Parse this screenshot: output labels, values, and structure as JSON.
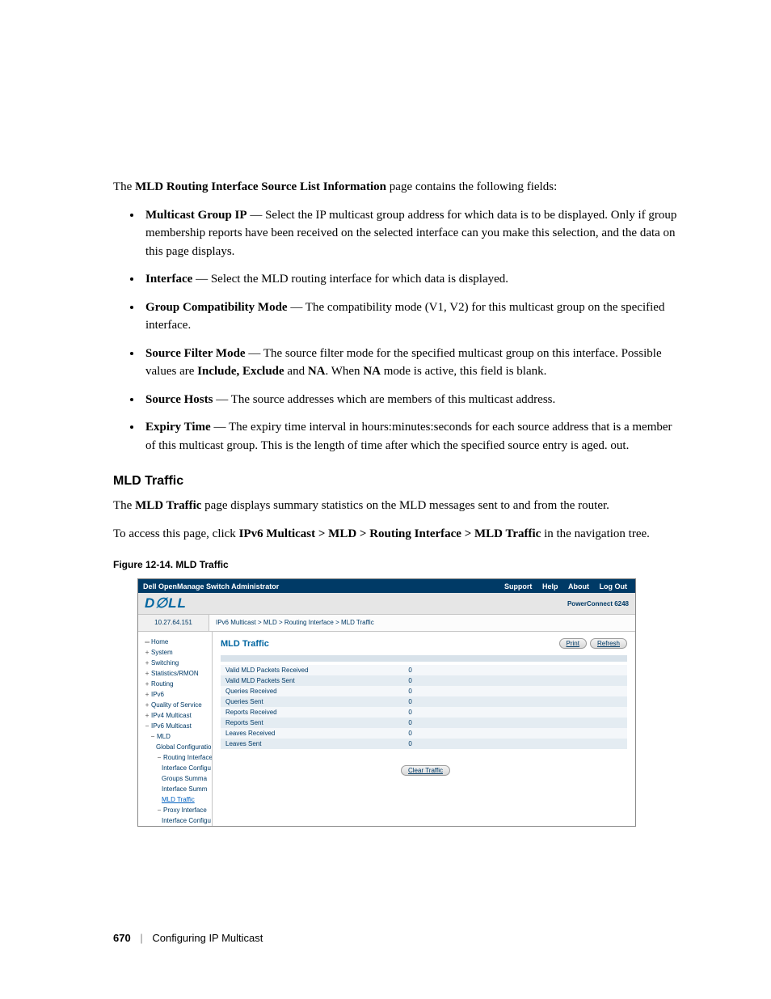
{
  "intro": {
    "page_name": "MLD Routing Interface Source List Information",
    "intro_tail": " page contains the following fields:"
  },
  "fields": [
    {
      "label": "Multicast Group IP",
      "text": " — Select the IP multicast group address for which data is to be displayed. Only if group membership reports have been received on the selected interface can you make this selection, and the data on this page displays."
    },
    {
      "label": "Interface",
      "text": " — Select the MLD routing interface for which data is displayed."
    },
    {
      "label": "Group Compatibility Mode",
      "text": " — The compatibility mode (V1, V2) for this multicast group on the specified interface."
    },
    {
      "label": "Source Filter Mode",
      "text_pre": " — The source filter mode for the specified multicast group on this interface. Possible values are ",
      "bold1": "Include, Exclude",
      "mid": " and ",
      "bold2": "NA",
      "mid2": ". When ",
      "bold3": "NA",
      "text_post": " mode is active, this field is blank."
    },
    {
      "label": "Source Hosts",
      "text": " — The source addresses which are members of this multicast address."
    },
    {
      "label": "Expiry Time",
      "text": " — The expiry time interval in hours:minutes:seconds for each source address that is a member of this multicast group. This is the length of time after which the specified source entry is aged. out."
    }
  ],
  "section_heading": "MLD Traffic",
  "para1_pre": "The ",
  "para1_bold": "MLD Traffic",
  "para1_post": " page displays summary statistics on the MLD messages sent to and from the router.",
  "para2_pre": "To access this page, click ",
  "para2_bold": "IPv6 Multicast > MLD > Routing Interface > MLD Traffic",
  "para2_post": " in the navigation tree.",
  "figure_caption": "Figure 12-14.    MLD Traffic",
  "shot": {
    "titlebar": "Dell OpenManage Switch Administrator",
    "top_links": [
      "Support",
      "Help",
      "About",
      "Log Out"
    ],
    "product": "PowerConnect 6248",
    "ip": "10.27.64.151",
    "breadcrumb": "IPv6 Multicast > MLD > Routing Interface > MLD Traffic",
    "tree": {
      "home": "Home",
      "system": "System",
      "switching": "Switching",
      "stats": "Statistics/RMON",
      "routing": "Routing",
      "ipv6": "IPv6",
      "qos": "Quality of Service",
      "ipv4m": "IPv4 Multicast",
      "ipv6m": "IPv6 Multicast",
      "mld": "MLD",
      "gconf": "Global Configuratio",
      "rif": "Routing Interface",
      "ifconf": "Interface Configu",
      "gsum": "Groups Summa",
      "ifsum": "Interface Summ",
      "mldtraf": "MLD Traffic",
      "proxy": "Proxy Interface",
      "ifconf2": "Interface Configu"
    },
    "page_title": "MLD Traffic",
    "buttons": {
      "print": "Print",
      "refresh": "Refresh",
      "clear": "Clear Traffic"
    },
    "rows": [
      {
        "label": "Valid MLD Packets Received",
        "value": "0"
      },
      {
        "label": "Valid MLD Packets Sent",
        "value": "0"
      },
      {
        "label": "Queries Received",
        "value": "0"
      },
      {
        "label": "Queries Sent",
        "value": "0"
      },
      {
        "label": "Reports Received",
        "value": "0"
      },
      {
        "label": "Reports Sent",
        "value": "0"
      },
      {
        "label": "Leaves Received",
        "value": "0"
      },
      {
        "label": "Leaves Sent",
        "value": "0"
      }
    ]
  },
  "footer": {
    "page": "670",
    "chapter": "Configuring IP Multicast"
  }
}
